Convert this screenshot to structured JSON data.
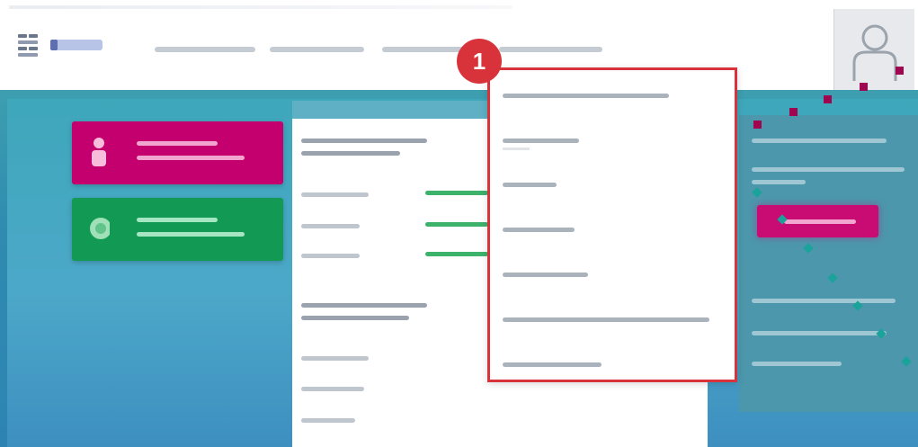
{
  "annotation": {
    "step_number": "1",
    "highlight_color": "#d8323a"
  },
  "colors": {
    "tile_pink": "#c4006f",
    "tile_green": "#129a55",
    "background_teal": "#3ea7ba",
    "dot_magenta": "#a0064f",
    "dot_teal": "#1aa39a"
  },
  "header": {
    "logo_icon": "company-logo",
    "avatar_icon": "user-avatar-icon",
    "nav_items_count": 4
  },
  "dropdown": {
    "items_count": 7
  },
  "tiles": [
    {
      "icon": "person-icon",
      "color": "#c4006f"
    },
    {
      "icon": "globe-icon",
      "color": "#129a55"
    }
  ]
}
